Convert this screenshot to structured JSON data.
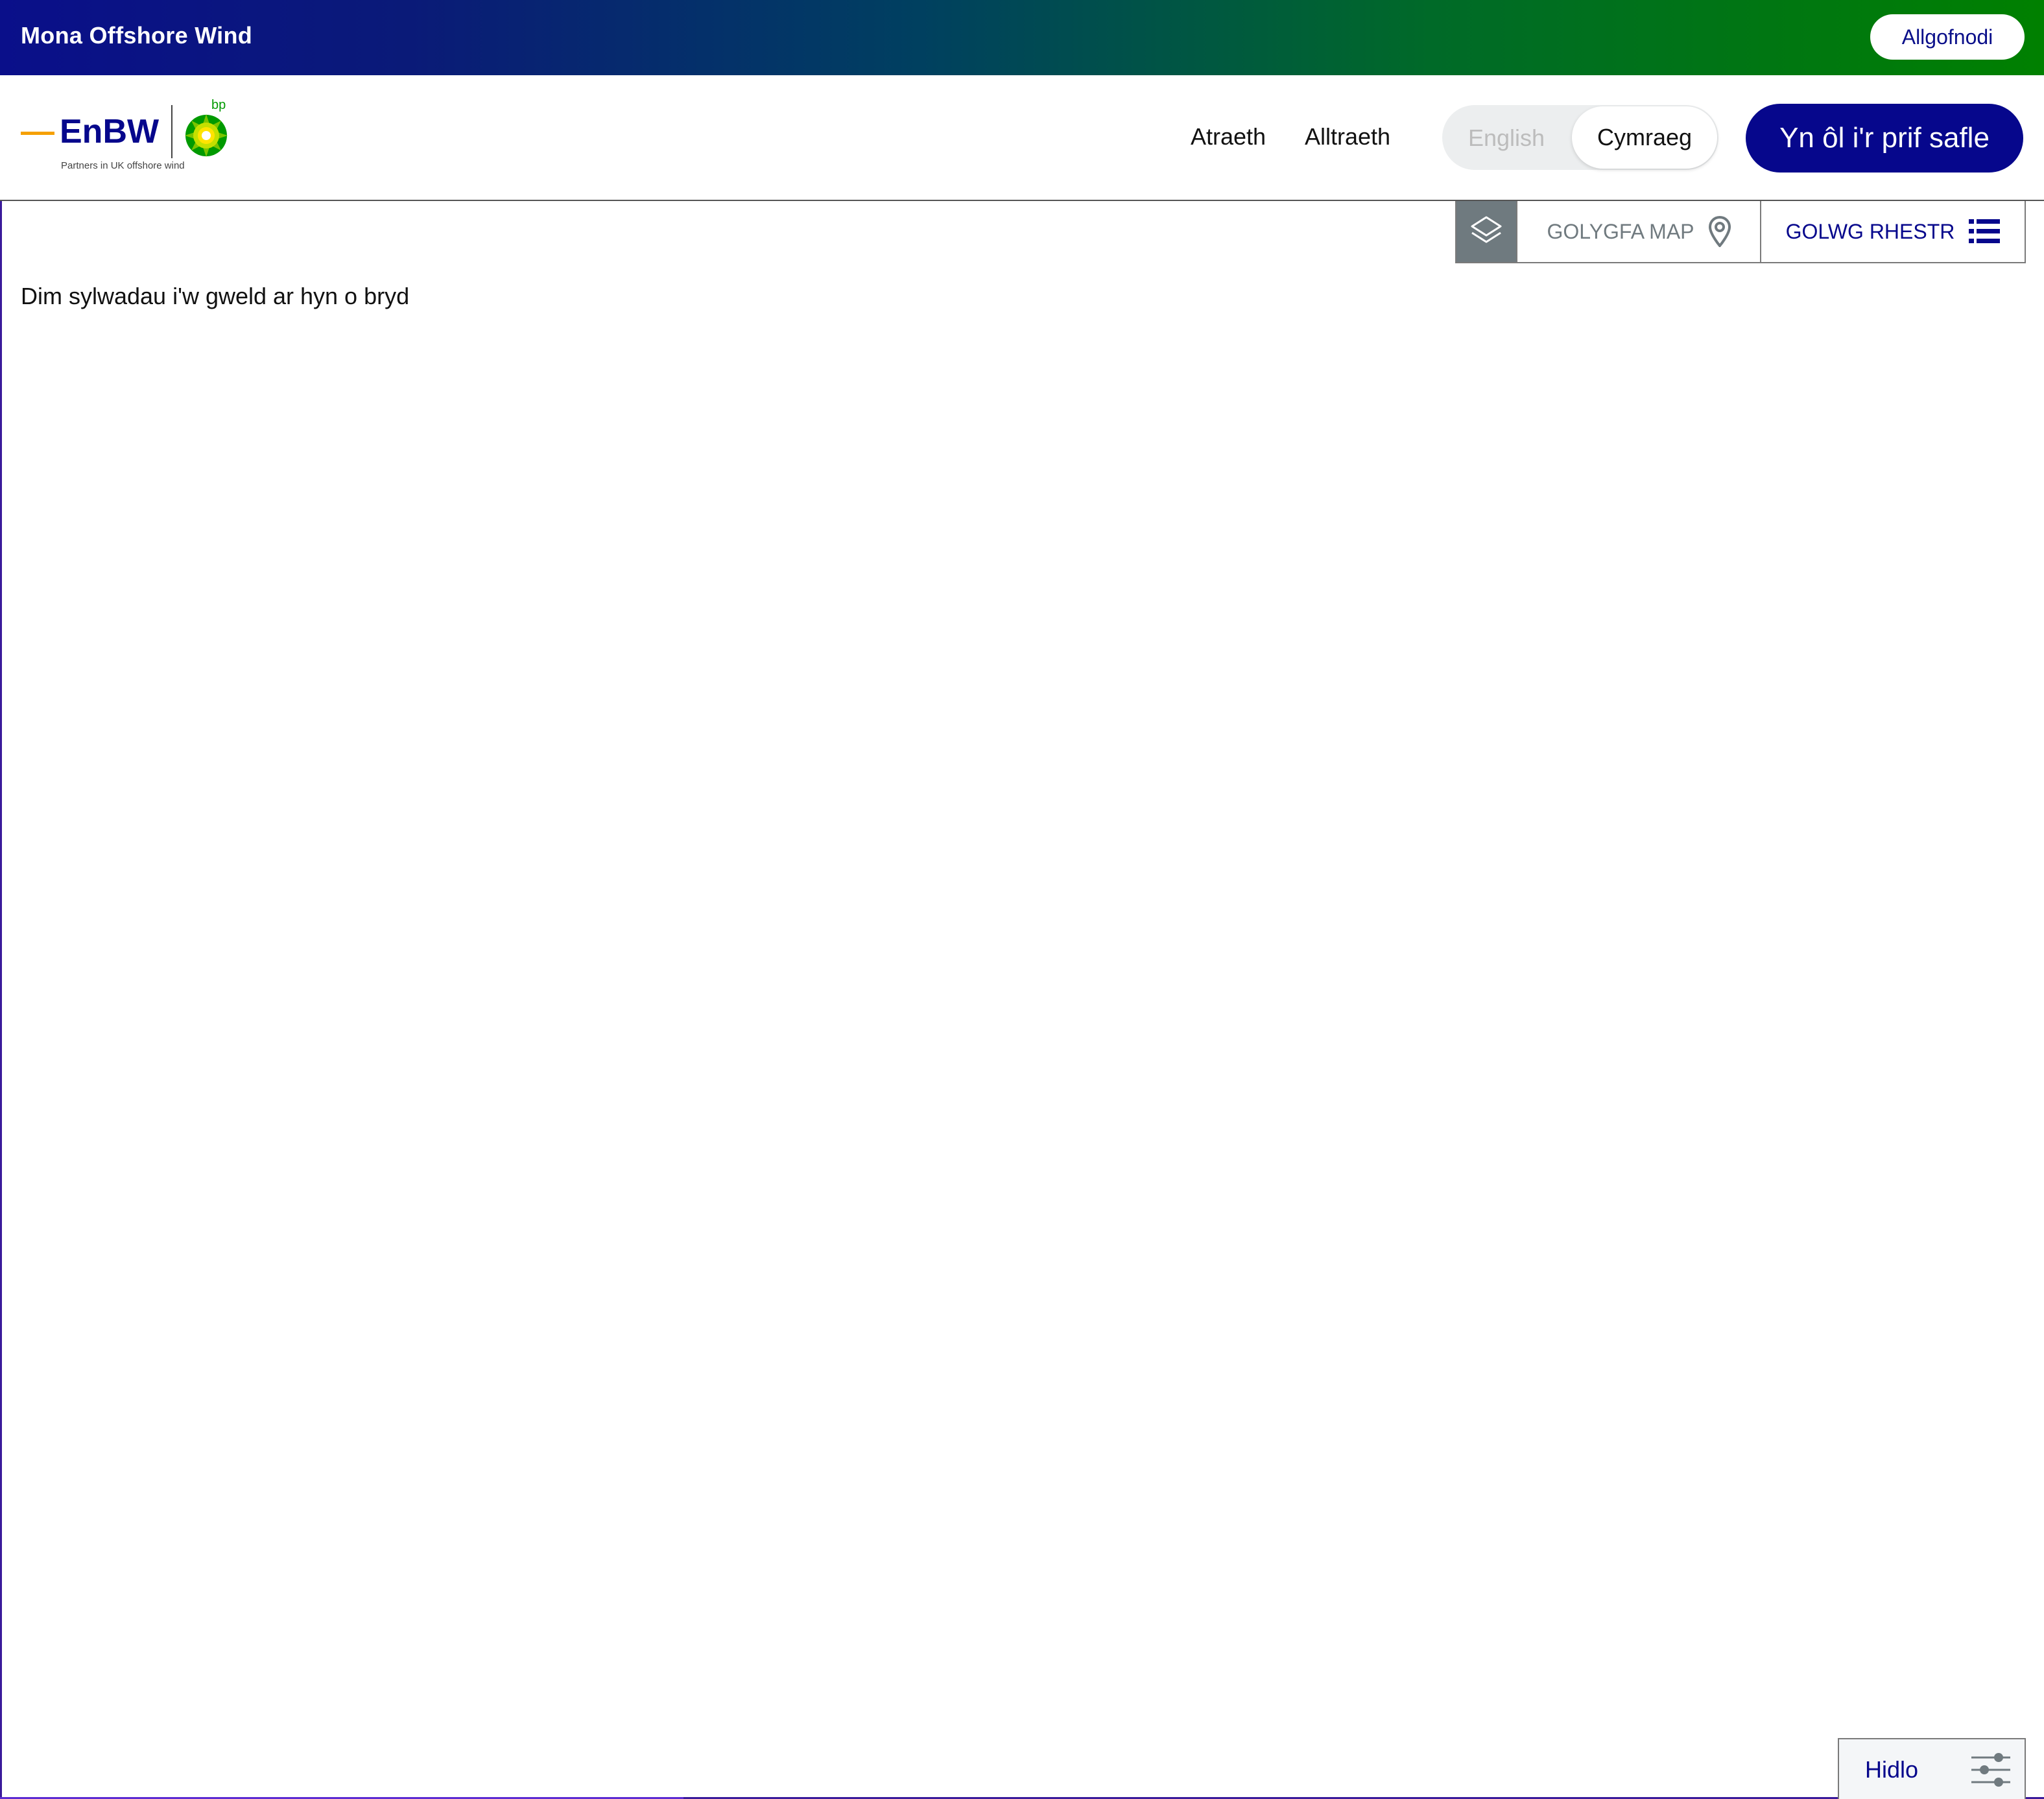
{
  "app": {
    "title": "Mona Offshore Wind",
    "logout_label": "Allgofnodi"
  },
  "logo": {
    "brand_text": "EnBW",
    "partner_text": "bp",
    "tagline": "Partners in UK offshore wind"
  },
  "nav": {
    "items": [
      {
        "label": "Atraeth"
      },
      {
        "label": "Alltraeth"
      }
    ]
  },
  "language": {
    "options": [
      "English",
      "Cymraeg"
    ],
    "selected": "Cymraeg"
  },
  "back_button_label": "Yn ôl i'r prif safle",
  "view_switch": {
    "layers_icon": "layers-icon",
    "map_label": "GOLYGFA MAP",
    "map_icon": "map-pin-icon",
    "list_label": "GOLWG RHESTR",
    "list_icon": "list-icon",
    "active": "list"
  },
  "main": {
    "empty_message": "Dim sylwadau i'w gweld ar hyn o bryd"
  },
  "filter": {
    "label": "Hidlo",
    "icon": "sliders-icon"
  },
  "colors": {
    "brand_navy": "#06078c",
    "gradient_start": "#0a0f8a",
    "gradient_end": "#008000",
    "muted_gray": "#6f7a7f"
  }
}
